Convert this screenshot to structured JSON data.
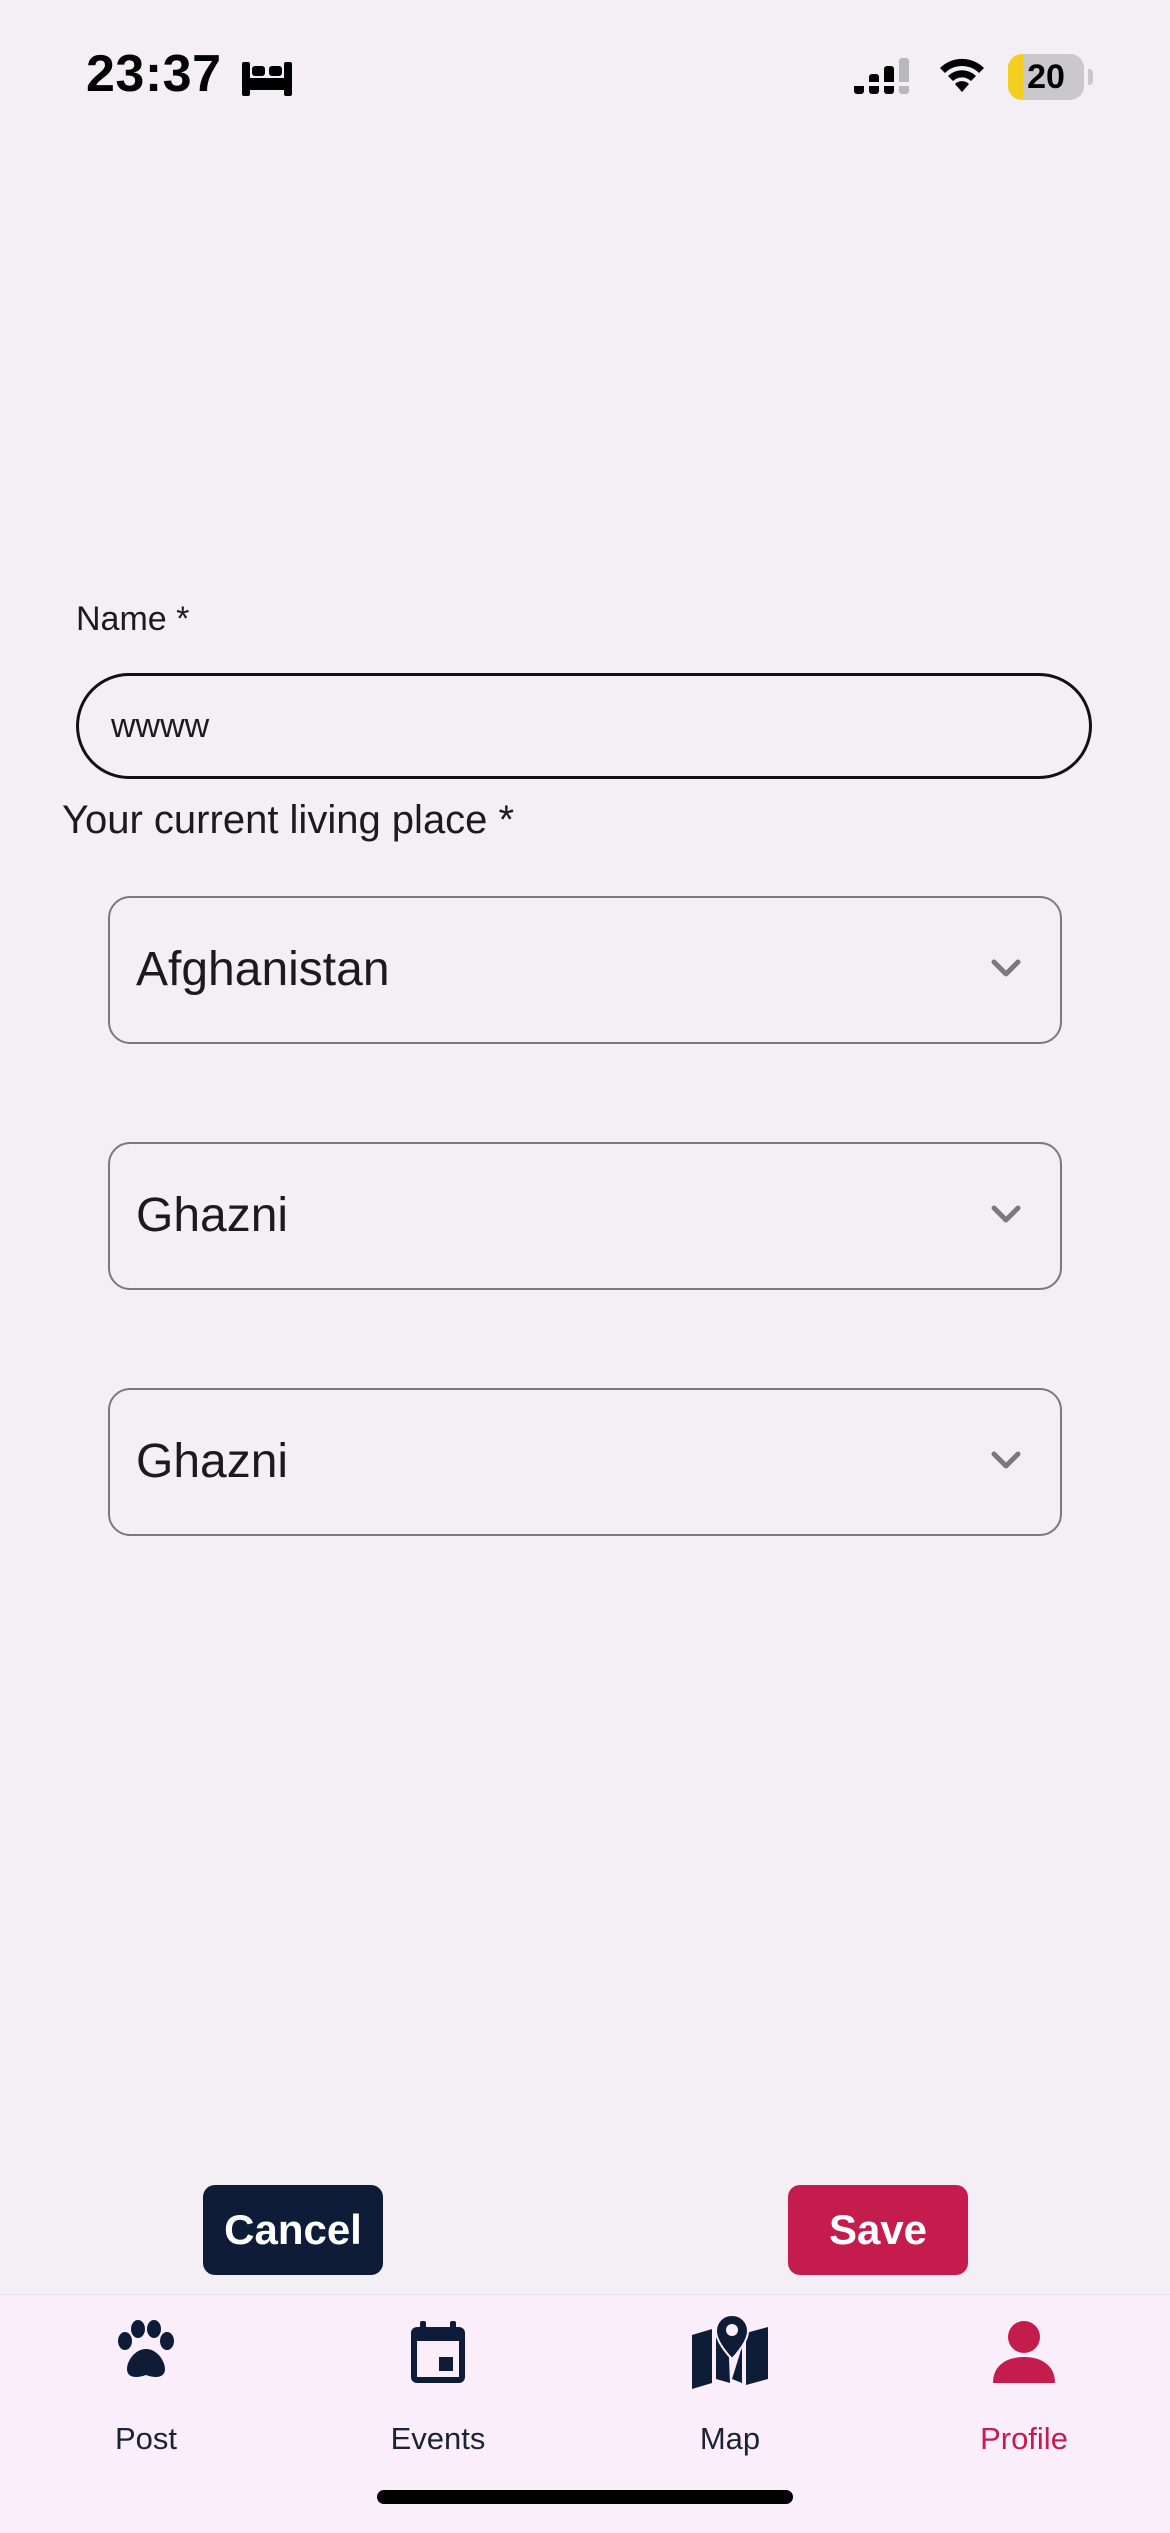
{
  "status_bar": {
    "time": "23:37",
    "battery_level": "20",
    "battery_fraction": 0.2,
    "icons": [
      "bed-icon",
      "cellular-signal-icon",
      "wifi-icon",
      "battery-icon"
    ]
  },
  "form": {
    "name_label": "Name *",
    "name_value": "wwww",
    "place_label": "Your current living place *",
    "country_value": "Afghanistan",
    "province_value": "Ghazni",
    "city_value": "Ghazni"
  },
  "actions": {
    "cancel_label": "Cancel",
    "save_label": "Save"
  },
  "nav": {
    "items": [
      {
        "label": "Post",
        "icon": "paw-icon"
      },
      {
        "label": "Events",
        "icon": "calendar-icon"
      },
      {
        "label": "Map",
        "icon": "map-icon"
      },
      {
        "label": "Profile",
        "icon": "person-icon",
        "active": true
      }
    ]
  },
  "colors": {
    "background": "#f4eef5",
    "primary_dark": "#0e1c38",
    "accent": "#c41c4d",
    "nav_background": "#fbeefb",
    "battery_low": "#f5cf1f"
  }
}
